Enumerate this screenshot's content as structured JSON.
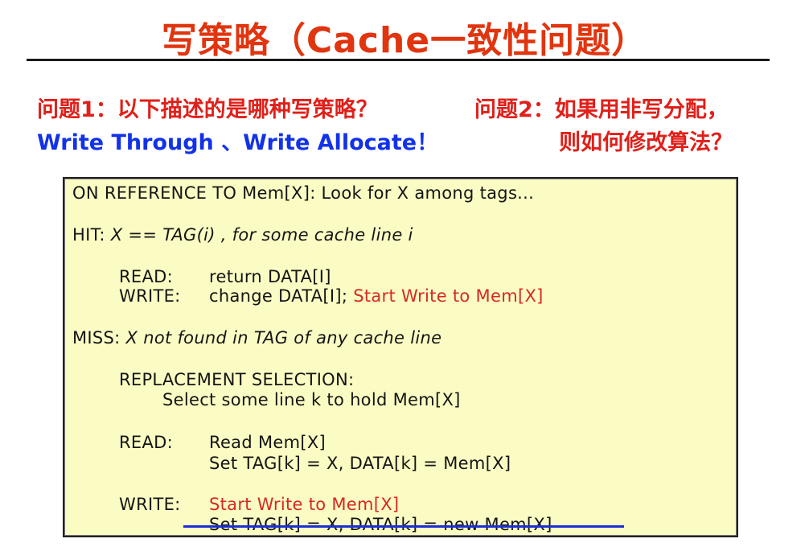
{
  "header": {
    "title": "写策略（Cache一致性问题）"
  },
  "questions": {
    "q1": "问题1：以下描述的是哪种写策略？",
    "q1_answer": "Write Through 、Write Allocate！",
    "q2_line1": "问题2：如果用非写分配，",
    "q2_line2": "则如何修改算法？"
  },
  "algorithm": {
    "on_reference": "ON REFERENCE TO Mem[X]: Look for X among tags...",
    "hit_label": "HIT:",
    "hit_text": "X == TAG(i) , for some cache line i",
    "hit_read_label": "READ:",
    "hit_read_text": "return DATA[I]",
    "hit_write_label": "WRITE:",
    "hit_write_text": "change DATA[I];",
    "hit_write_action": "Start Write to Mem[X]",
    "miss_label": "MISS:",
    "miss_text": "X not found in TAG of any cache line",
    "replacement_label": "REPLACEMENT SELECTION:",
    "replacement_text": "Select some line k to hold Mem[X]",
    "miss_read_label": "READ:",
    "miss_read_line1": "Read Mem[X]",
    "miss_read_line2": "Set TAG[k] = X, DATA[k] = Mem[X]",
    "miss_write_label": "WRITE:",
    "miss_write_action": "Start Write to Mem[X]",
    "miss_write_struck": "Set TAG[k] = X, DATA[k] = new Mem[X]"
  },
  "colors": {
    "title": "#e0350f",
    "question": "#e0201a",
    "answer": "#1232e8",
    "highlight": "#d52a22",
    "panel_bg": "#fbfbc4",
    "strike_line": "#1c2fd6"
  }
}
